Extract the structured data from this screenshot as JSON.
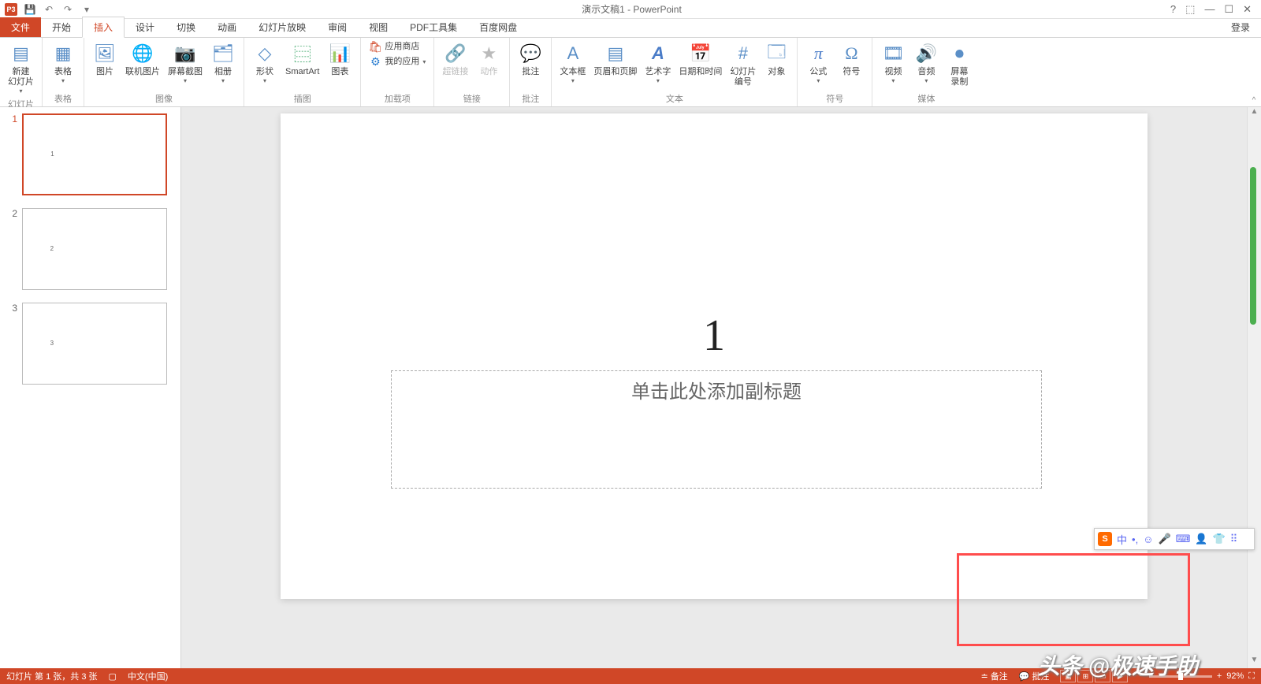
{
  "app": {
    "title": "演示文稿1 - PowerPoint",
    "icon_letter": "P3"
  },
  "qat": {
    "save": "💾",
    "undo": "↶",
    "redo": "↷",
    "start": "▾"
  },
  "window": {
    "help": "?",
    "ribbon_opts": "⬚",
    "min": "—",
    "max": "☐",
    "close": "✕"
  },
  "tabs": {
    "file": "文件",
    "home": "开始",
    "insert": "插入",
    "design": "设计",
    "transitions": "切换",
    "animations": "动画",
    "slideshow": "幻灯片放映",
    "review": "审阅",
    "view": "视图",
    "pdftools": "PDF工具集",
    "baidu": "百度网盘",
    "signin": "登录"
  },
  "ribbon": {
    "groups": {
      "slides": {
        "label": "幻灯片",
        "new_slide": "新建\n幻灯片"
      },
      "tables": {
        "label": "表格",
        "table": "表格"
      },
      "images": {
        "label": "图像",
        "picture": "图片",
        "online_picture": "联机图片",
        "screenshot": "屏幕截图",
        "album": "相册"
      },
      "illustrations": {
        "label": "插图",
        "shapes": "形状",
        "smartart": "SmartArt",
        "chart": "图表"
      },
      "addins": {
        "label": "加载项",
        "store": "应用商店",
        "myapps": "我的应用"
      },
      "links": {
        "label": "链接",
        "hyperlink": "超链接",
        "action": "动作"
      },
      "comments": {
        "label": "批注",
        "comment": "批注"
      },
      "text": {
        "label": "文本",
        "textbox": "文本框",
        "header_footer": "页眉和页脚",
        "wordart": "艺术字",
        "datetime": "日期和时间",
        "slide_number": "幻灯片\n编号",
        "object": "对象"
      },
      "symbols": {
        "label": "符号",
        "equation": "公式",
        "symbol": "符号"
      },
      "media": {
        "label": "媒体",
        "video": "视频",
        "audio": "音频",
        "screen_rec": "屏幕\n录制"
      }
    }
  },
  "thumbs": [
    {
      "num": "1",
      "content": "1",
      "selected": true
    },
    {
      "num": "2",
      "content": "2",
      "selected": false
    },
    {
      "num": "3",
      "content": "3",
      "selected": false
    }
  ],
  "slide": {
    "title_text": "1",
    "subtitle_placeholder": "单击此处添加副标题"
  },
  "ime": {
    "logo": "S",
    "lang": "中",
    "i1": "•,",
    "i2": "☺",
    "i3": "🎤",
    "i4": "⌨",
    "i5": "👤",
    "i6": "👕",
    "i7": "⠿"
  },
  "watermark": "头条 @极速手助",
  "status": {
    "slide_info": "幻灯片 第 1 张，共 3 张",
    "spell": "▢",
    "lang": "中文(中国)",
    "notes": "备注",
    "comments": "批注",
    "zoom_pct": "92%",
    "fit": "⛶"
  }
}
